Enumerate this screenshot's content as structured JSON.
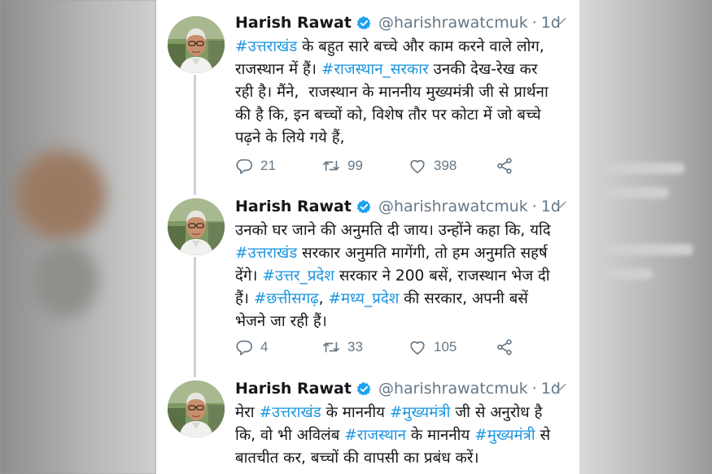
{
  "tweets": [
    {
      "author_name": "Harish Rawat",
      "handle": "@harishrawatcmuk",
      "separator": "·",
      "time": "1d",
      "lines": [
        [
          {
            "t": "#उत्तराखंड",
            "tag": true
          },
          {
            "t": " के बहुत सारे बच्चे और काम करने वाले लोग,",
            "tag": false
          }
        ],
        [
          {
            "t": "राजस्थान में हैं। ",
            "tag": false
          },
          {
            "t": "#राजस्थान_सरकार",
            "tag": true
          },
          {
            "t": " उनकी देख-रेख कर",
            "tag": false
          }
        ],
        [
          {
            "t": "रही है। मैंने,  राजस्थान के माननीय मुख्यमंत्री जी से प्रार्थना",
            "tag": false
          }
        ],
        [
          {
            "t": "की है कि, इन बच्चों को, विशेष तौर पर कोटा में जो बच्चे",
            "tag": false
          }
        ],
        [
          {
            "t": "पढ़ने के लिये गये हैं,",
            "tag": false
          }
        ]
      ],
      "replies": "21",
      "retweets": "99",
      "likes": "398"
    },
    {
      "author_name": "Harish Rawat",
      "handle": "@harishrawatcmuk",
      "separator": "·",
      "time": "1d",
      "lines": [
        [
          {
            "t": "उनको घर जाने की अनुमति दी जाय। उन्होंने कहा कि, यदि",
            "tag": false
          }
        ],
        [
          {
            "t": "#उत्तराखंड",
            "tag": true
          },
          {
            "t": " सरकार अनुमति मागेंगी, तो हम अनुमति सहर्ष",
            "tag": false
          }
        ],
        [
          {
            "t": "देंगे। ",
            "tag": false
          },
          {
            "t": "#उत्तर_प्रदेश",
            "tag": true
          },
          {
            "t": " सरकार ने 200 बसें, राजस्थान भेज दी",
            "tag": false
          }
        ],
        [
          {
            "t": "हैं। ",
            "tag": false
          },
          {
            "t": "#छत्तीसगढ़",
            "tag": true
          },
          {
            "t": ", ",
            "tag": false
          },
          {
            "t": "#मध्य_प्रदेश",
            "tag": true
          },
          {
            "t": " की सरकार, अपनी बसें",
            "tag": false
          }
        ],
        [
          {
            "t": "भेजने जा रही हैं।",
            "tag": false
          }
        ]
      ],
      "replies": "4",
      "retweets": "33",
      "likes": "105"
    },
    {
      "author_name": "Harish Rawat",
      "handle": "@harishrawatcmuk",
      "separator": "·",
      "time": "1d",
      "lines": [
        [
          {
            "t": "मेरा ",
            "tag": false
          },
          {
            "t": "#उत्तराखंड",
            "tag": true
          },
          {
            "t": " के माननीय ",
            "tag": false
          },
          {
            "t": "#मुख्यमंत्री",
            "tag": true
          },
          {
            "t": " जी से अनुरोध है",
            "tag": false
          }
        ],
        [
          {
            "t": "कि, वो भी अविलंब ",
            "tag": false
          },
          {
            "t": "#राजस्थान",
            "tag": true
          },
          {
            "t": " के माननीय ",
            "tag": false
          },
          {
            "t": "#मुख्यमंत्री",
            "tag": true
          },
          {
            "t": " से",
            "tag": false
          }
        ],
        [
          {
            "t": "बातचीत कर, बच्चों की वापसी का प्रबंध करें।",
            "tag": false
          }
        ]
      ]
    }
  ],
  "icons": {
    "verified": "verified-badge-icon",
    "caret": "chevron-down-icon",
    "reply": "reply-icon",
    "retweet": "retweet-icon",
    "like": "heart-icon",
    "share": "share-icon"
  },
  "colors": {
    "link": "#1b95e0",
    "text": "#14171a",
    "secondary": "#657786",
    "verified": "#1da1f2"
  }
}
